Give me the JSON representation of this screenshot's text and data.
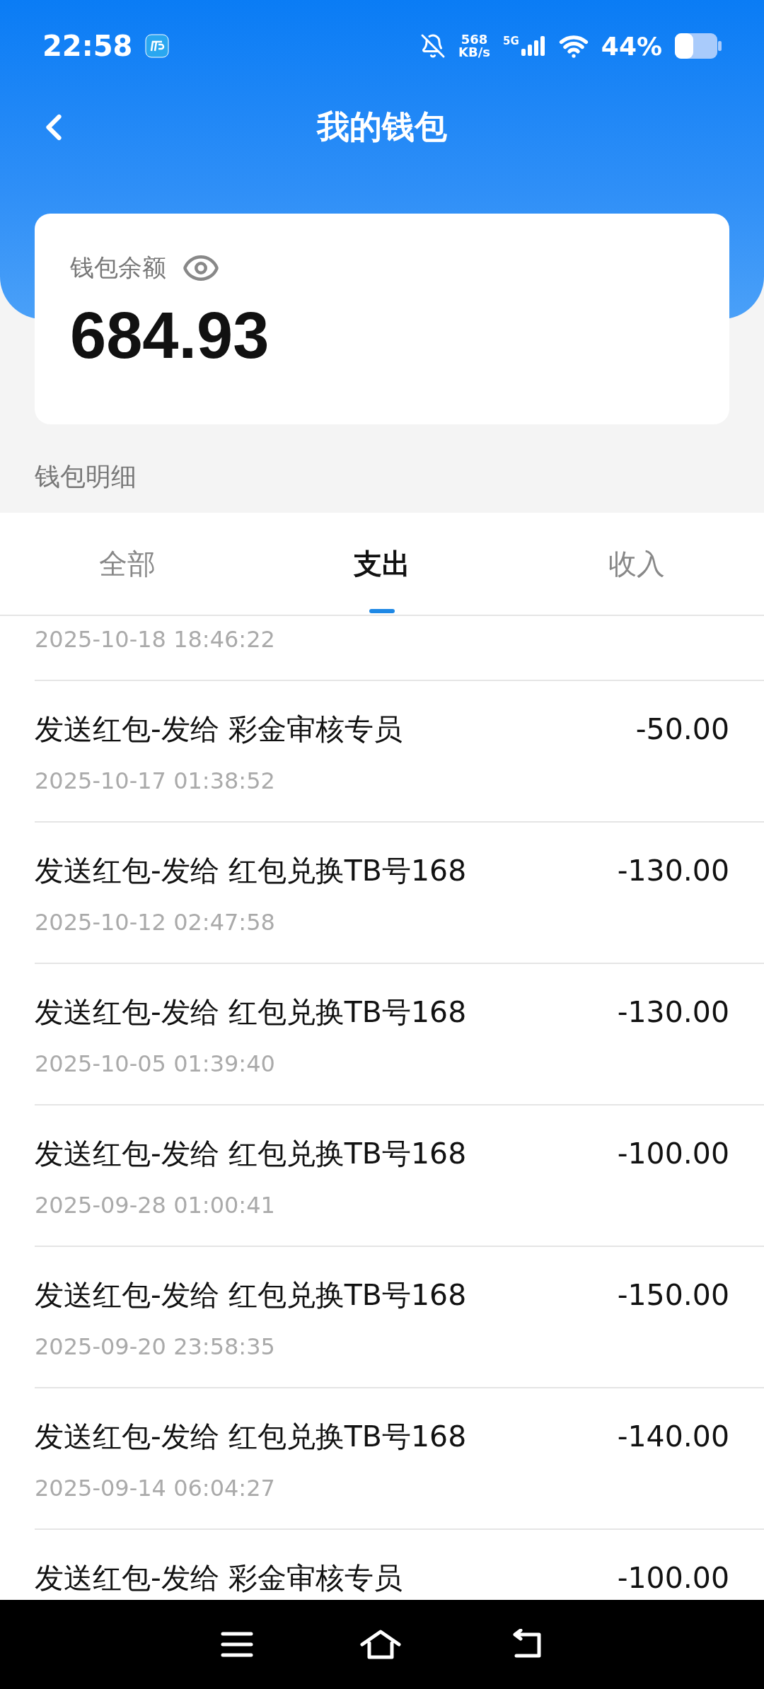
{
  "status_bar": {
    "time": "22:58",
    "net_speed_value": "568",
    "net_speed_unit": "KB/s",
    "network": "5G",
    "battery": "44%"
  },
  "header": {
    "title": "我的钱包"
  },
  "balance": {
    "label": "钱包余额",
    "amount": "684.93"
  },
  "section_title": "钱包明细",
  "tabs": [
    {
      "label": "全部",
      "selected": false
    },
    {
      "label": "支出",
      "selected": true
    },
    {
      "label": "收入",
      "selected": false
    }
  ],
  "transactions": [
    {
      "date": "2025-10-18 18:46:22"
    },
    {
      "title": "发送红包-发给 彩金审核专员",
      "amount": "-50.00",
      "date": "2025-10-17 01:38:52"
    },
    {
      "title": "发送红包-发给 红包兑换TB号168",
      "amount": "-130.00",
      "date": "2025-10-12 02:47:58"
    },
    {
      "title": "发送红包-发给 红包兑换TB号168",
      "amount": "-130.00",
      "date": "2025-10-05 01:39:40"
    },
    {
      "title": "发送红包-发给 红包兑换TB号168",
      "amount": "-100.00",
      "date": "2025-09-28 01:00:41"
    },
    {
      "title": "发送红包-发给 红包兑换TB号168",
      "amount": "-150.00",
      "date": "2025-09-20 23:58:35"
    },
    {
      "title": "发送红包-发给 红包兑换TB号168",
      "amount": "-140.00",
      "date": "2025-09-14 06:04:27"
    },
    {
      "title": "发送红包-发给 彩金审核专员",
      "amount": "-100.00"
    }
  ]
}
